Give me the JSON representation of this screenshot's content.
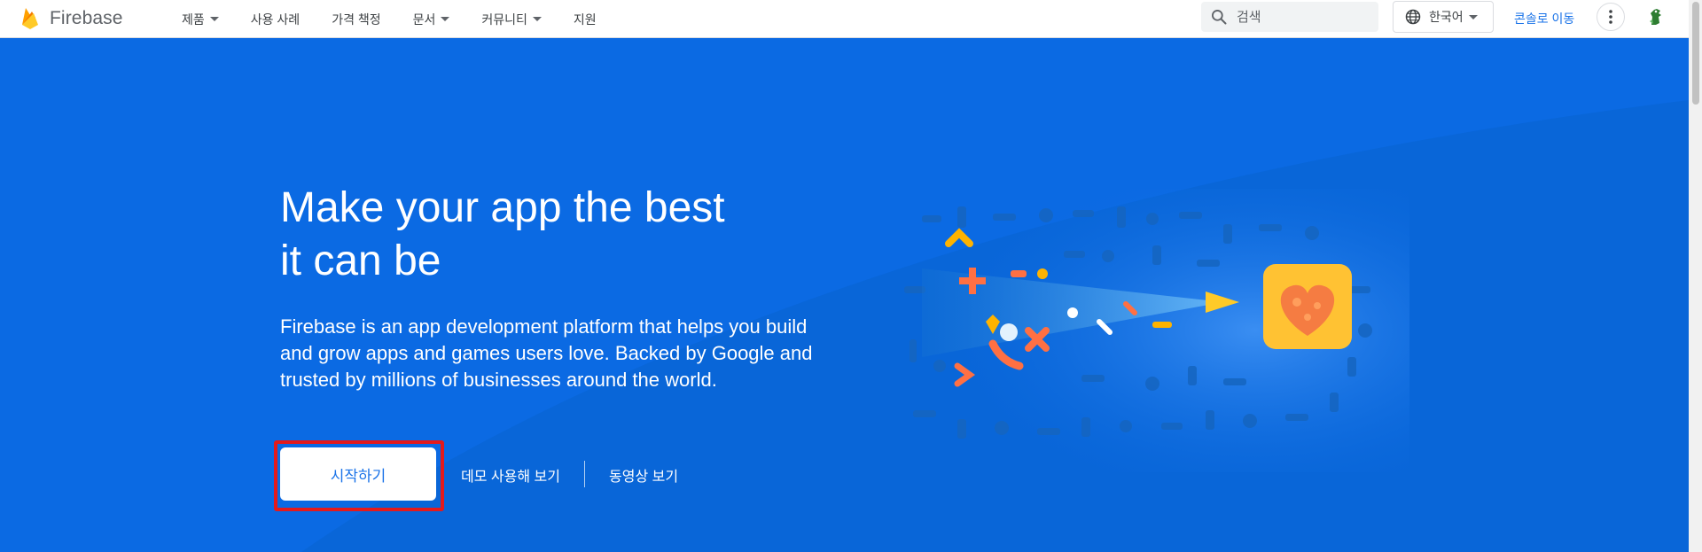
{
  "header": {
    "brand": "Firebase",
    "nav": [
      {
        "label": "제품",
        "dropdown": true
      },
      {
        "label": "사용 사례",
        "dropdown": false
      },
      {
        "label": "가격 책정",
        "dropdown": false
      },
      {
        "label": "문서",
        "dropdown": true
      },
      {
        "label": "커뮤니티",
        "dropdown": true
      },
      {
        "label": "지원",
        "dropdown": false
      }
    ],
    "search_placeholder": "검색",
    "language": "한국어",
    "console_link": "콘솔로 이동"
  },
  "hero": {
    "headline": "Make your app the best it can be",
    "description": "Firebase is an app development platform that helps you build and grow apps and games users love. Backed by Google and trusted by millions of businesses around the world.",
    "primary_cta": "시작하기",
    "demo_link": "데모 사용해 보기",
    "video_link": "동영상 보기"
  },
  "colors": {
    "hero_bg": "#0b6ae3",
    "link": "#1a73e8",
    "highlight_outline": "#e41a1c",
    "brand_orange": "#ffa000"
  }
}
